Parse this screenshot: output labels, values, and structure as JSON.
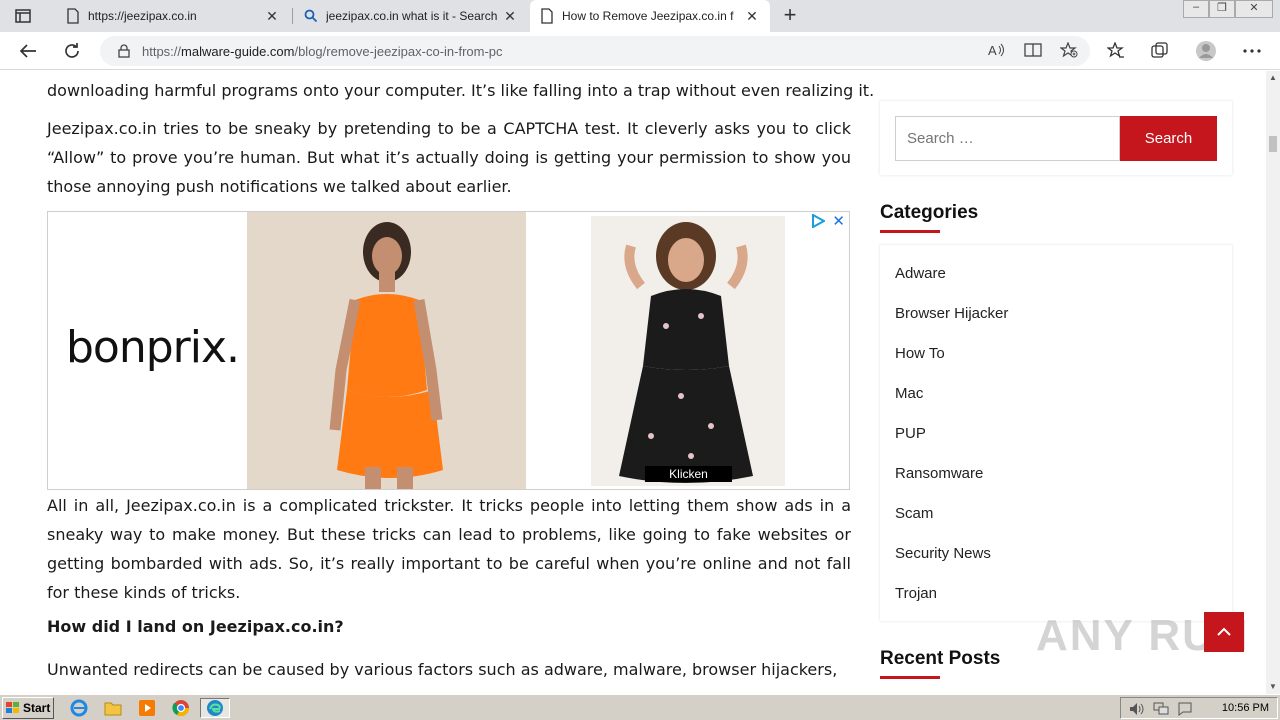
{
  "browser": {
    "tabs": [
      {
        "title": "https://jeezipax.co.in",
        "icon": "page-icon"
      },
      {
        "title": "jeezipax.co.in what is it - Search",
        "icon": "search-icon"
      },
      {
        "title": "How to Remove Jeezipax.co.in f",
        "icon": "page-icon"
      }
    ],
    "active_tab": 2,
    "url_prefix": "https://",
    "url_host": "malware-guide.com",
    "url_path": "/blog/remove-jeezipax-co-in-from-pc"
  },
  "article": {
    "p0": "downloading harmful programs onto your computer. It’s like falling into a trap without even realizing it.",
    "p1": "Jeezipax.co.in tries to be sneaky by pretending to be a CAPTCHA test. It cleverly asks you to click “Allow” to prove you’re human. But what it’s actually doing is getting your permission to show you those annoying push notifications we talked about earlier.",
    "ad": {
      "brand": "bonprix.",
      "cta": "Klicken",
      "close": "✕"
    },
    "p2": "All in all, Jeezipax.co.in is a complicated trickster. It tricks people into letting them show ads in a sneaky way to make money. But these tricks can lead to problems, like going to fake websites or getting bombarded with ads. So, it’s really important to be careful when you’re online and not fall for these kinds of tricks.",
    "h3": "How did I land on Jeezipax.co.in?",
    "p3": "Unwanted redirects can be caused by various factors such as adware, malware, browser hijackers,"
  },
  "sidebar": {
    "search_placeholder": "Search …",
    "search_button": "Search",
    "categories_title": "Categories",
    "categories": [
      "Adware",
      "Browser Hijacker",
      "How To",
      "Mac",
      "PUP",
      "Ransomware",
      "Scam",
      "Security News",
      "Trojan"
    ],
    "recent_posts_title": "Recent Posts"
  },
  "watermark": "ANY RUN",
  "taskbar": {
    "start_label": "Start",
    "clock": "10:56 PM"
  },
  "colors": {
    "accent": "#c4161c",
    "tabbar": "#dfe1e5",
    "taskbar": "#d4d0c8"
  }
}
